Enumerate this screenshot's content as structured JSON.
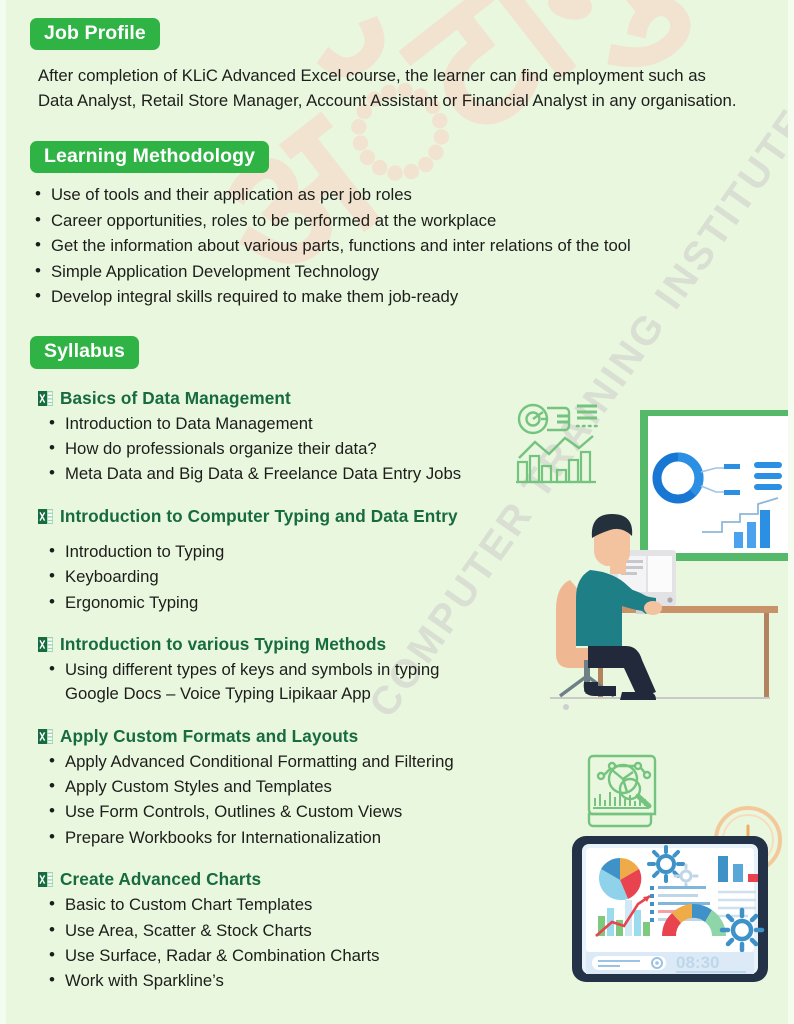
{
  "theme": {
    "page_bg": "#e9f7df",
    "badge_green": "#2fb345",
    "heading_green": "#176b3e",
    "body_text": "#1d1d1b",
    "watermark_tan": "#f2e2cf",
    "watermark_grey": "#d9dfd2",
    "accent_blue": "#2b8fe3",
    "teal": "#1f7f86"
  },
  "watermark": {
    "script_text": "अॅटागुरु",
    "institute_text": "COMPUTER TRAINING INSTITUTE"
  },
  "sections": {
    "job_profile": {
      "badge": "Job Profile",
      "paragraph": "After completion of KLiC Advanced Excel course, the learner can find employment such as Data Analyst, Retail Store Manager, Account Assistant or Financial Analyst in any organisation."
    },
    "learning_methodology": {
      "badge": "Learning Methodology",
      "items": [
        "Use of tools and their application as per job roles",
        "Career opportunities, roles to be performed at the workplace",
        "Get the information about various parts, functions and inter relations of the tool",
        "Simple Application Development Technology",
        "Develop integral skills required to make them job-ready"
      ]
    },
    "syllabus": {
      "badge": "Syllabus",
      "groups": [
        {
          "icon": "excel-file-icon",
          "title": "Basics of Data Management",
          "items": [
            "Introduction to Data Management",
            "How do professionals organize their data?",
            "Meta Data and Big Data & Freelance Data Entry Jobs"
          ]
        },
        {
          "icon": "excel-file-icon",
          "title": "Introduction to Computer Typing and Data Entry",
          "items": [
            "Introduction to Typing",
            "Keyboarding",
            "Ergonomic Typing"
          ]
        },
        {
          "icon": "excel-file-icon",
          "title": "Introduction to various Typing Methods",
          "items": [
            "Using different types of keys and symbols in typing",
            "Google Docs – Voice Typing Lipikaar App"
          ]
        },
        {
          "icon": "excel-file-icon",
          "title": " Apply Custom Formats and Layouts",
          "items": [
            "Apply Advanced Conditional Formatting and Filtering",
            "Apply Custom Styles and Templates",
            "Use Form Controls, Outlines & Custom Views",
            "Prepare Workbooks for Internationalization"
          ]
        },
        {
          "icon": "excel-file-icon",
          "title": "Create Advanced Charts",
          "items": [
            "Basic to Custom Chart Templates",
            "Use Area, Scatter & Stock Charts",
            "Use Surface, Radar & Combination Charts",
            "Work with Sparkline’s"
          ]
        }
      ]
    }
  },
  "illustrations": {
    "analytics_line_icon": "analytics-chart-outline-icon",
    "desk_scene": "person-at-desk-with-presentation-board-illustration",
    "report_icon": "data-report-magnifier-outline-icon",
    "dashboard_scene": "tablet-dashboard-with-clock-illustration",
    "dashboard_clock_label": "08:30"
  }
}
